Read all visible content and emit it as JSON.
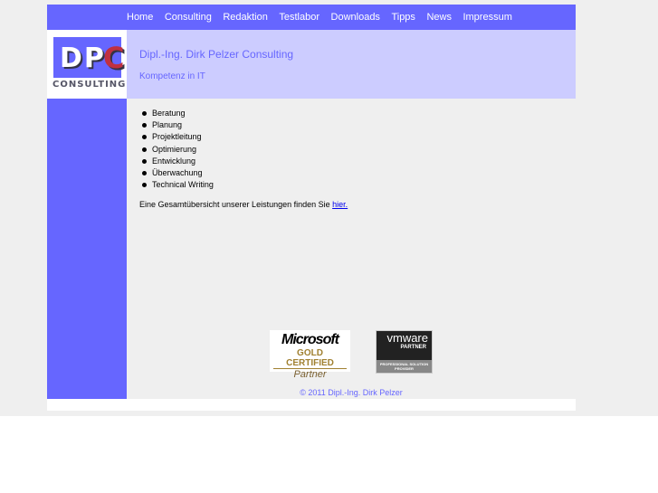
{
  "nav": {
    "items": [
      "Home",
      "Consulting",
      "Redaktion",
      "Testlabor",
      "Downloads",
      "Tipps",
      "News",
      "Impressum"
    ]
  },
  "logo": {
    "text": "DPC",
    "sub": "CONSULTING"
  },
  "header": {
    "title": "Dipl.-Ing. Dirk Pelzer Consulting",
    "subtitle": "Kompetenz in IT"
  },
  "services": [
    "Beratung",
    "Planung",
    "Projektleitung",
    "Optimierung",
    "Entwicklung",
    "Überwachung",
    "Technical Writing"
  ],
  "summary": {
    "text": "Eine Gesamtübersicht unserer Leistungen finden Sie ",
    "link": "hier."
  },
  "badges": {
    "microsoft": [
      "Microsoft",
      "GOLD CERTIFIED",
      "Partner"
    ],
    "vmware": [
      "vmware",
      "PARTNER",
      "PROFESSIONAL SOLUTION PROVIDER"
    ]
  },
  "footer": {
    "copyright": "© 2011 Dipl.-Ing. Dirk Pelzer"
  },
  "colors": {
    "primary": "#6666ff",
    "header": "#ccccff"
  }
}
